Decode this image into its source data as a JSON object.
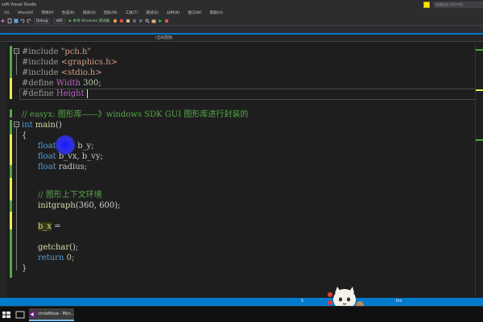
{
  "window": {
    "title": "soft Visual Studio",
    "quick_launch_placeholder": "快速启动 (Ctrl+Q)"
  },
  "menu": {
    "items": [
      "(V)",
      "VAssistX",
      "项目(P)",
      "生成(B)",
      "调试(D)",
      "团队(M)",
      "工具(T)",
      "测试(S)",
      "分析(N)",
      "窗口(W)",
      "帮助(H)"
    ]
  },
  "toolbar": {
    "config": "Debug",
    "platform": "x86",
    "run_label": "本地 Windows 调试器"
  },
  "navbar": {
    "scope": "(全局范围)"
  },
  "code": {
    "line1_kw": "#include",
    "line1_str": "\"pch.h\"",
    "line2_kw": "#include",
    "line2_str": "<graphics.h>",
    "line3_kw": "#include",
    "line3_str": "<stdio.h>",
    "line4_kw": "#define",
    "line4_name": "Width",
    "line4_val": "300;",
    "line5_kw": "#define",
    "line5_name": "Height",
    "comment": "// easyx: 图形库——》windows SDK GUI 图形库进行封装的",
    "main_kw": "int",
    "main_fn": "main",
    "brace_open": "{",
    "decl1_type": "float",
    "decl1_vars": "b_x, b_y;",
    "decl2_type": "float",
    "decl2_vars": "b_vx, b_vy;",
    "decl3_type": "float",
    "decl3_vars": "radius;",
    "comment2": "// 图形上下文环境",
    "initgraph_fn": "initgraph",
    "initgraph_args": "(360, 600);",
    "assign_var": "b_x",
    "assign_op": " =",
    "getchar_fn": "getchar",
    "getchar_rest": "();",
    "return_kw": "return",
    "return_val": "0;",
    "brace_close": "}"
  },
  "status": {
    "col_label": "5",
    "ins_label": "Ins"
  },
  "taskbar": {
    "active_label": "circleMove - Micr..."
  },
  "colors": {
    "accent": "#007acc",
    "keyword": "#569cd6",
    "comment": "#57a64a",
    "string": "#d69d85",
    "macro": "#bd63c5",
    "function": "#dcdcaa"
  }
}
